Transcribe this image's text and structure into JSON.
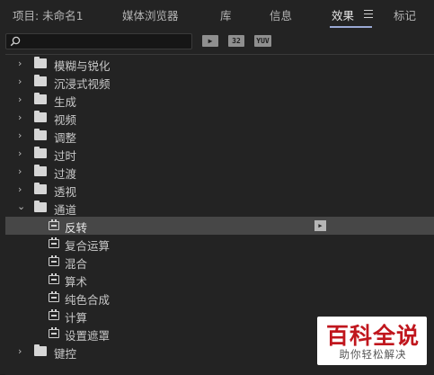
{
  "tabs": [
    {
      "label": "项目: 未命名1"
    },
    {
      "label": "媒体浏览器"
    },
    {
      "label": "库"
    },
    {
      "label": "信息"
    },
    {
      "label": "效果"
    },
    {
      "label": "标记"
    }
  ],
  "active_tab": "效果",
  "search": {
    "value": "",
    "placeholder": ""
  },
  "toolbar_icons": [
    {
      "name": "accelerated-effects-icon",
      "glyph": "▶"
    },
    {
      "name": "32-bit-effects-icon",
      "glyph": "32"
    },
    {
      "name": "yuv-effects-icon",
      "glyph": "YUV"
    }
  ],
  "tree": [
    {
      "label": "模糊与锐化",
      "type": "folder",
      "expanded": false
    },
    {
      "label": "沉浸式视频",
      "type": "folder",
      "expanded": false
    },
    {
      "label": "生成",
      "type": "folder",
      "expanded": false
    },
    {
      "label": "视频",
      "type": "folder",
      "expanded": false
    },
    {
      "label": "调整",
      "type": "folder",
      "expanded": false
    },
    {
      "label": "过时",
      "type": "folder",
      "expanded": false
    },
    {
      "label": "过渡",
      "type": "folder",
      "expanded": false
    },
    {
      "label": "透视",
      "type": "folder",
      "expanded": false
    },
    {
      "label": "通道",
      "type": "folder",
      "expanded": true
    },
    {
      "label": "反转",
      "type": "effect",
      "selected": true,
      "accelerated": true
    },
    {
      "label": "复合运算",
      "type": "effect"
    },
    {
      "label": "混合",
      "type": "effect"
    },
    {
      "label": "算术",
      "type": "effect"
    },
    {
      "label": "纯色合成",
      "type": "effect"
    },
    {
      "label": "计算",
      "type": "effect"
    },
    {
      "label": "设置遮罩",
      "type": "effect"
    },
    {
      "label": "键控",
      "type": "folder",
      "expanded": false
    }
  ],
  "watermark": {
    "main": "百科全说",
    "sub": "助你轻松解决"
  },
  "colors": {
    "background": "#232323",
    "selected_row": "#474747",
    "tab_underline": "#9aa9d4",
    "watermark_red": "#c0161d"
  }
}
